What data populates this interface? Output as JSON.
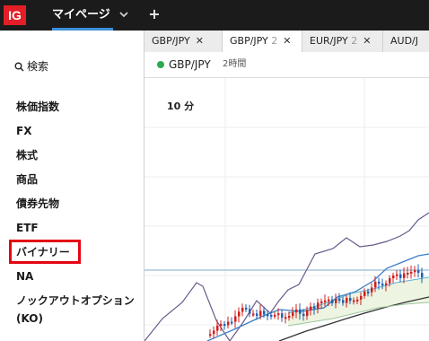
{
  "topbar": {
    "logo": "IG",
    "my_page": "マイページ",
    "add": "+"
  },
  "sidebar": {
    "search_label": "検索",
    "items": [
      {
        "label": "株価指数"
      },
      {
        "label": "FX"
      },
      {
        "label": "株式"
      },
      {
        "label": "商品"
      },
      {
        "label": "債券先物"
      },
      {
        "label": "ETF"
      },
      {
        "label": "バイナリー"
      },
      {
        "label": "NA"
      },
      {
        "label": "ノックアウトオプション"
      },
      {
        "label": "(KO)"
      }
    ],
    "highlight_color": "#e30613"
  },
  "tabs": [
    {
      "label": "GBP/JPY",
      "suffix": "",
      "close": "✕"
    },
    {
      "label": "GBP/JPY",
      "suffix": "2",
      "close": "✕"
    },
    {
      "label": "EUR/JPY",
      "suffix": "2",
      "close": "✕"
    },
    {
      "label": "AUD/J",
      "suffix": "",
      "close": ""
    }
  ],
  "chart": {
    "instrument": "GBP/JPY",
    "period": "2時間",
    "interval": "10 分",
    "status_color": "#2fa84f"
  }
}
